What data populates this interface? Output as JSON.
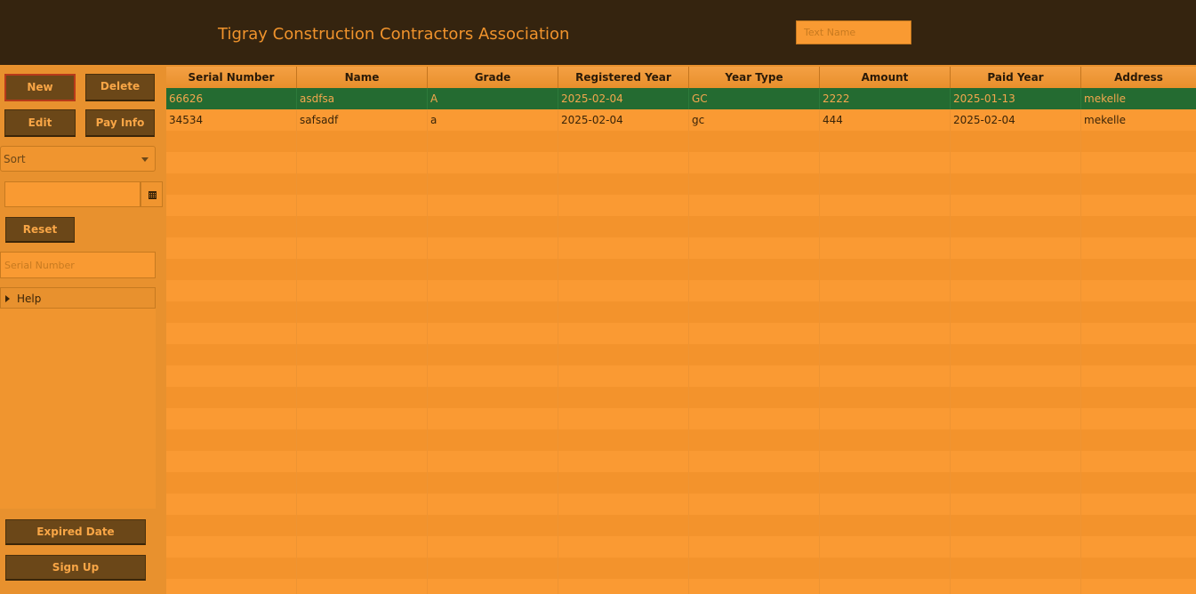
{
  "header": {
    "title": "Tigray Construction Contractors Association",
    "name_placeholder": "Text Name"
  },
  "sidebar": {
    "new_label": "New",
    "delete_label": "Delete",
    "edit_label": "Edit",
    "pay_info_label": "Pay Info",
    "sort_label": "Sort",
    "reset_label": "Reset",
    "serial_placeholder": "Serial Number",
    "help_label": "Help",
    "expired_label": "Expired Date",
    "signup_label": "Sign Up"
  },
  "table": {
    "columns": [
      "Serial Number",
      "Name",
      "Grade",
      "Registered Year",
      "Year Type",
      "Amount",
      "Paid Year",
      "Address"
    ],
    "rows": [
      [
        "66626",
        "asdfsa",
        "A",
        "2025-02-04",
        "GC",
        "2222",
        "2025-01-13",
        "mekelle"
      ],
      [
        "34534",
        "safsadf",
        "a",
        "2025-02-04",
        "gc",
        "444",
        "2025-02-04",
        "mekelle"
      ]
    ],
    "selected_row": 0
  },
  "colors": {
    "header_bg": "#35240f",
    "accent": "#f0932c",
    "button_bg": "#6b4718",
    "selected_row": "#246b31"
  }
}
